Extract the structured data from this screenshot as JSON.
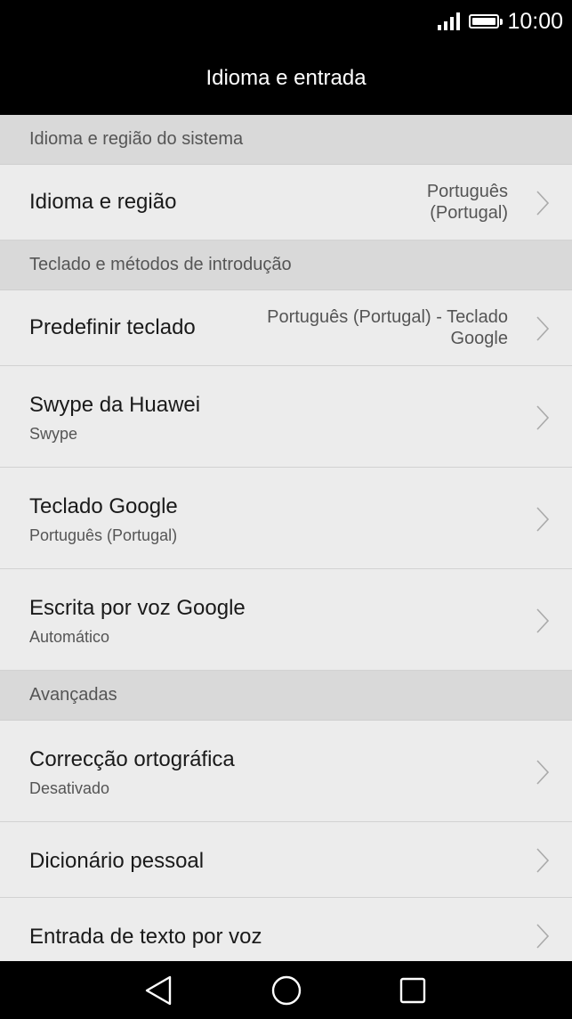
{
  "status_bar": {
    "time": "10:00",
    "signal_icon": "signal-icon",
    "battery_icon": "battery-icon"
  },
  "app_bar": {
    "title": "Idioma e entrada"
  },
  "sections": [
    {
      "header": "Idioma e região do sistema"
    },
    {
      "header": "Teclado e métodos de introdução"
    },
    {
      "header": "Avançadas"
    }
  ],
  "items": {
    "language_region": {
      "title": "Idioma e região",
      "value_line1": "Português",
      "value_line2": "(Portugal)"
    },
    "default_keyboard": {
      "title": "Predefinir teclado",
      "value_line1": "Português (Portugal) - Teclado",
      "value_line2": "Google"
    },
    "huawei_swype": {
      "title": "Swype da Huawei",
      "subtitle": "Swype"
    },
    "google_keyboard": {
      "title": "Teclado Google",
      "subtitle": "Português (Portugal)"
    },
    "google_voice_typing": {
      "title": "Escrita por voz Google",
      "subtitle": "Automático"
    },
    "spell_check": {
      "title": "Correcção ortográfica",
      "subtitle": "Desativado"
    },
    "personal_dictionary": {
      "title": "Dicionário pessoal"
    },
    "voice_input": {
      "title": "Entrada de texto por voz"
    }
  },
  "nav_bar": {
    "back_icon": "back-icon",
    "home_icon": "home-icon",
    "recents_icon": "recents-icon"
  }
}
